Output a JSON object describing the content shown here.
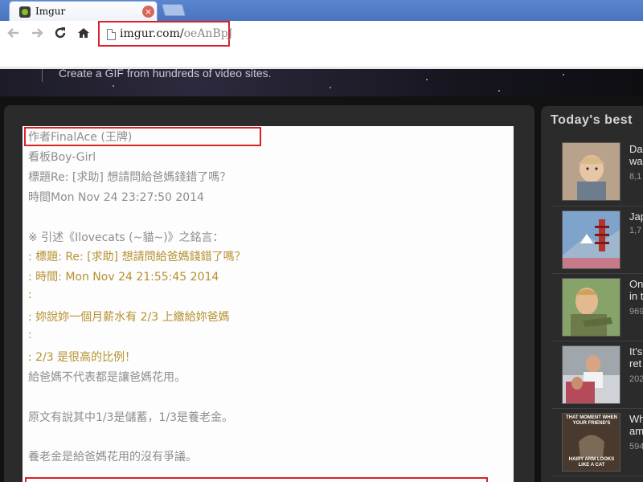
{
  "browser": {
    "tab_title": "Imgur",
    "close_glyph": "×",
    "url_host": "imgur.com/",
    "url_path": "oeAnBpJ"
  },
  "icons": {
    "back": "back-arrow-icon",
    "forward": "forward-arrow-icon",
    "reload": "reload-icon",
    "home": "home-icon",
    "page": "page-icon",
    "favicon": "imgur-favicon-icon"
  },
  "colors": {
    "highlight_box": "#d8232a",
    "quote_text": "#b69130",
    "body_text": "#8d8d8d"
  },
  "banner": {
    "text": "Create a GIF from hundreds of video sites."
  },
  "post": {
    "lines": [
      {
        "text": "作者FinalAce (王牌)",
        "quote": false
      },
      {
        "text": "看板Boy-Girl",
        "quote": false
      },
      {
        "text": "標題Re: [求助] 想請問給爸媽錢錯了嗎？",
        "quote": false
      },
      {
        "text": "時間Mon Nov 24 23:27:50 2014",
        "quote": false
      },
      {
        "text": "",
        "quote": false
      },
      {
        "text": "※ 引述《Ilovecats (~貓~)》之銘言：",
        "quote": false
      },
      {
        "text": ": 標題: Re: [求助] 想請問給爸媽錢錯了嗎？",
        "quote": true
      },
      {
        "text": ": 時間: Mon Nov 24 21:55:45 2014",
        "quote": true
      },
      {
        "text": ":",
        "quote": true
      },
      {
        "text": ": 妳說妳一個月薪水有 2/3 上繳給妳爸媽",
        "quote": true
      },
      {
        "text": ":",
        "quote": true
      },
      {
        "text": ": 2/3 是很高的比例！",
        "quote": true
      },
      {
        "text": "給爸媽不代表都是讓爸媽花用。",
        "quote": false
      },
      {
        "text": "",
        "quote": false
      },
      {
        "text": "原文有說其中1/3是儲蓄，1/3是養老金。",
        "quote": false
      },
      {
        "text": "",
        "quote": false
      },
      {
        "text": "養老金是給爸媽花用的沒有爭議。",
        "quote": false
      }
    ]
  },
  "sidebar": {
    "title": "Today's best",
    "items": [
      {
        "title_1": "Da",
        "title_2": "wa",
        "meta": "8,1"
      },
      {
        "title_1": "Jap",
        "title_2": "",
        "meta": "1,7"
      },
      {
        "title_1": "On",
        "title_2": "in t",
        "meta": "969"
      },
      {
        "title_1": "It's",
        "title_2": "ret",
        "meta": "202"
      },
      {
        "title_1": "Wh",
        "title_2": "am",
        "meta": "594"
      }
    ],
    "meme_text_top": "THAT MOMENT WHEN YOUR FRIEND'S",
    "meme_text_bottom": "HAIRY ARM LOOKS LIKE A CAT"
  }
}
